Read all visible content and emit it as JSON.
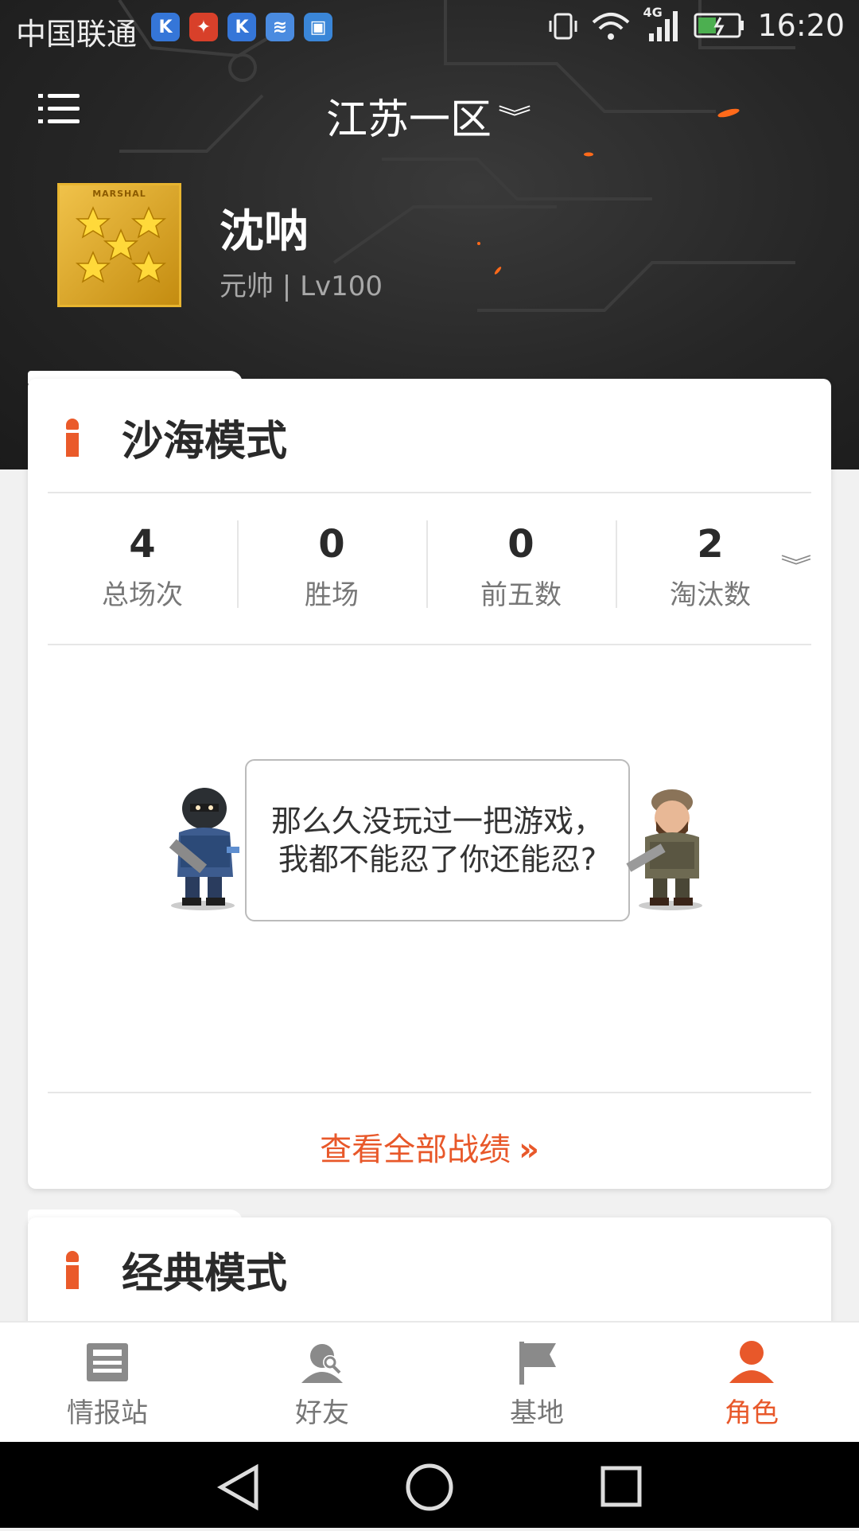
{
  "status_bar": {
    "carrier": "中国联通",
    "time": "16:20",
    "network": "4G",
    "notification_icons": [
      "k-app-icon",
      "fish-app-icon",
      "k-app-icon",
      "wifi-app-icon",
      "gallery-app-icon"
    ]
  },
  "header": {
    "server": "江苏一区"
  },
  "profile": {
    "name": "沈呐",
    "rank_text": "元帅 | Lv100",
    "badge_text": "MARSHAL"
  },
  "modes": [
    {
      "title": "沙海模式",
      "stats": [
        {
          "value": "4",
          "label": "总场次"
        },
        {
          "value": "0",
          "label": "胜场"
        },
        {
          "value": "0",
          "label": "前五数"
        },
        {
          "value": "2",
          "label": "淘汰数"
        }
      ],
      "empty_message": "那么久没玩过一把游戏，我都不能忍了你还能忍?",
      "view_all": "查看全部战绩",
      "view_all_arrow": "»"
    },
    {
      "title": "经典模式"
    }
  ],
  "bottom_nav": [
    {
      "label": "情报站",
      "icon": "news-icon",
      "active": false
    },
    {
      "label": "好友",
      "icon": "friends-icon",
      "active": false
    },
    {
      "label": "基地",
      "icon": "flag-icon",
      "active": false
    },
    {
      "label": "角色",
      "icon": "person-icon",
      "active": true
    }
  ],
  "colors": {
    "accent": "#e8582a",
    "hero_bg": "#262626",
    "gold": "#e8b530"
  }
}
